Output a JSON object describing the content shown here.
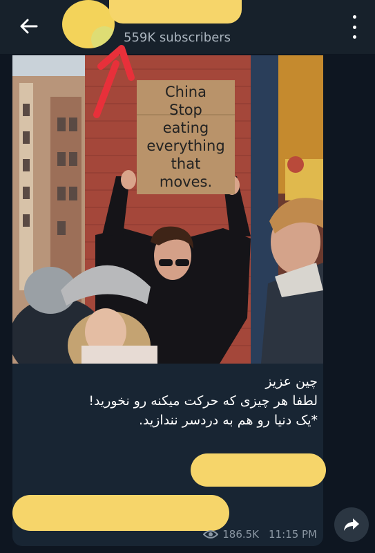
{
  "header": {
    "subscribers": "559K subscribers",
    "back_icon": "arrow-left-icon",
    "menu_icon": "kebab-menu-icon"
  },
  "post": {
    "sign_lines": [
      "China",
      "Stop",
      "eating",
      "everything",
      "that",
      "moves."
    ],
    "caption_lines": [
      "چین عزیز",
      "لطفا هر چیزی که حرکت میکنه رو نخورید!",
      "*یک دنیا رو هم به دردسر نندازید."
    ],
    "views": "186.5K",
    "time": "11:15 PM",
    "share_icon": "share-forward-icon"
  },
  "colors": {
    "background": "#0e1621",
    "header": "#17212b",
    "bubble": "#182533",
    "redaction": "#f6d56a",
    "annotation_arrow": "#e8303a"
  }
}
